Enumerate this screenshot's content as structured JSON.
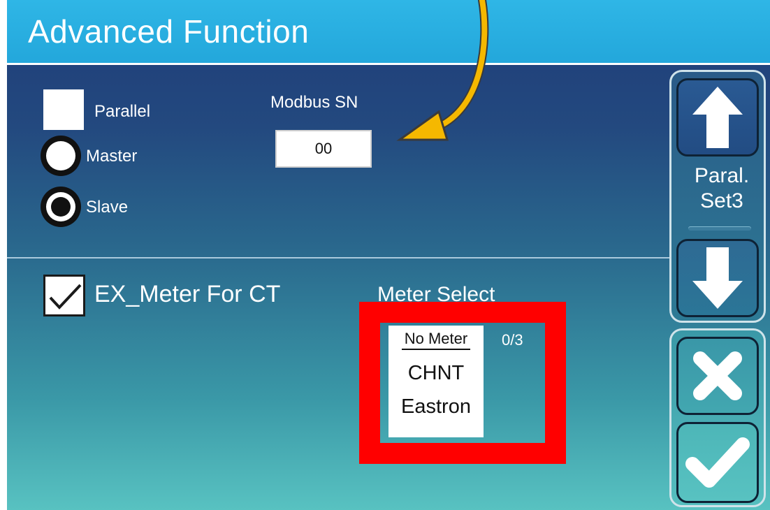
{
  "window": {
    "title": "Advanced Function"
  },
  "parallel": {
    "checkbox_label": "Parallel",
    "checked": false,
    "radio_master_label": "Master",
    "radio_slave_label": "Slave",
    "selected_role": "Slave"
  },
  "modbus": {
    "label": "Modbus SN",
    "value": "00"
  },
  "meter": {
    "checkbox_label": "EX_Meter For CT",
    "checked": true,
    "select_label": "Meter Select",
    "options": [
      "No Meter",
      "CHNT",
      "Eastron"
    ],
    "selected": "No Meter",
    "page_count": "0/3"
  },
  "side_panel": {
    "page_label_line1": "Paral.",
    "page_label_line2": "Set3",
    "buttons": [
      "up-arrow-icon",
      "down-arrow-icon",
      "close-icon",
      "check-icon"
    ]
  },
  "colors": {
    "title_bar": "#23a7db",
    "background_top": "#1f3c78",
    "background_bottom": "#58c2c1",
    "highlight_box": "#ff0000",
    "annotation_arrow": "#f5b800"
  }
}
